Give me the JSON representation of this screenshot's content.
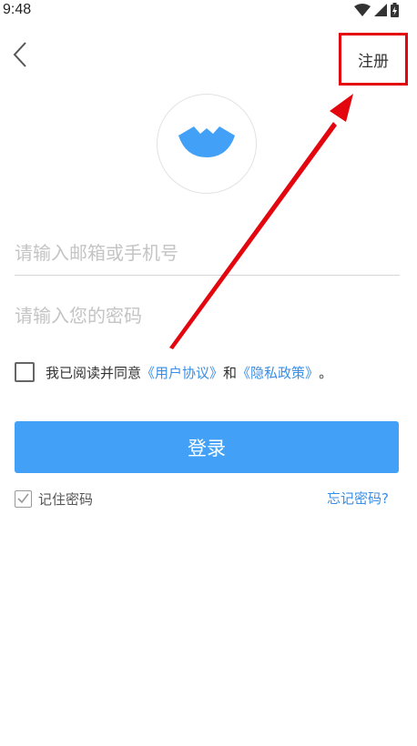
{
  "status_bar": {
    "time": "9:48",
    "icons": [
      "wifi-icon",
      "signal-icon",
      "battery-charging-icon"
    ]
  },
  "top_bar": {
    "back_icon": "chevron-left-icon",
    "register_label": "注册"
  },
  "logo": {
    "icon": "paper-boat-icon",
    "color": "#42a1f7"
  },
  "form": {
    "account_placeholder": "请输入邮箱或手机号",
    "account_value": "",
    "password_placeholder": "请输入您的密码",
    "password_value": ""
  },
  "agreement": {
    "checked": false,
    "prefix": "我已阅读并同意",
    "user_agreement_link": "《用户协议》",
    "conjunction": "和",
    "privacy_policy_link": "《隐私政策》",
    "suffix": "。"
  },
  "login": {
    "button_label": "登录",
    "color": "#42a1f7"
  },
  "remember": {
    "checked": true,
    "label": "记住密码"
  },
  "forgot_password_label": "忘记密码?",
  "annotation": {
    "color": "#e4060f"
  }
}
